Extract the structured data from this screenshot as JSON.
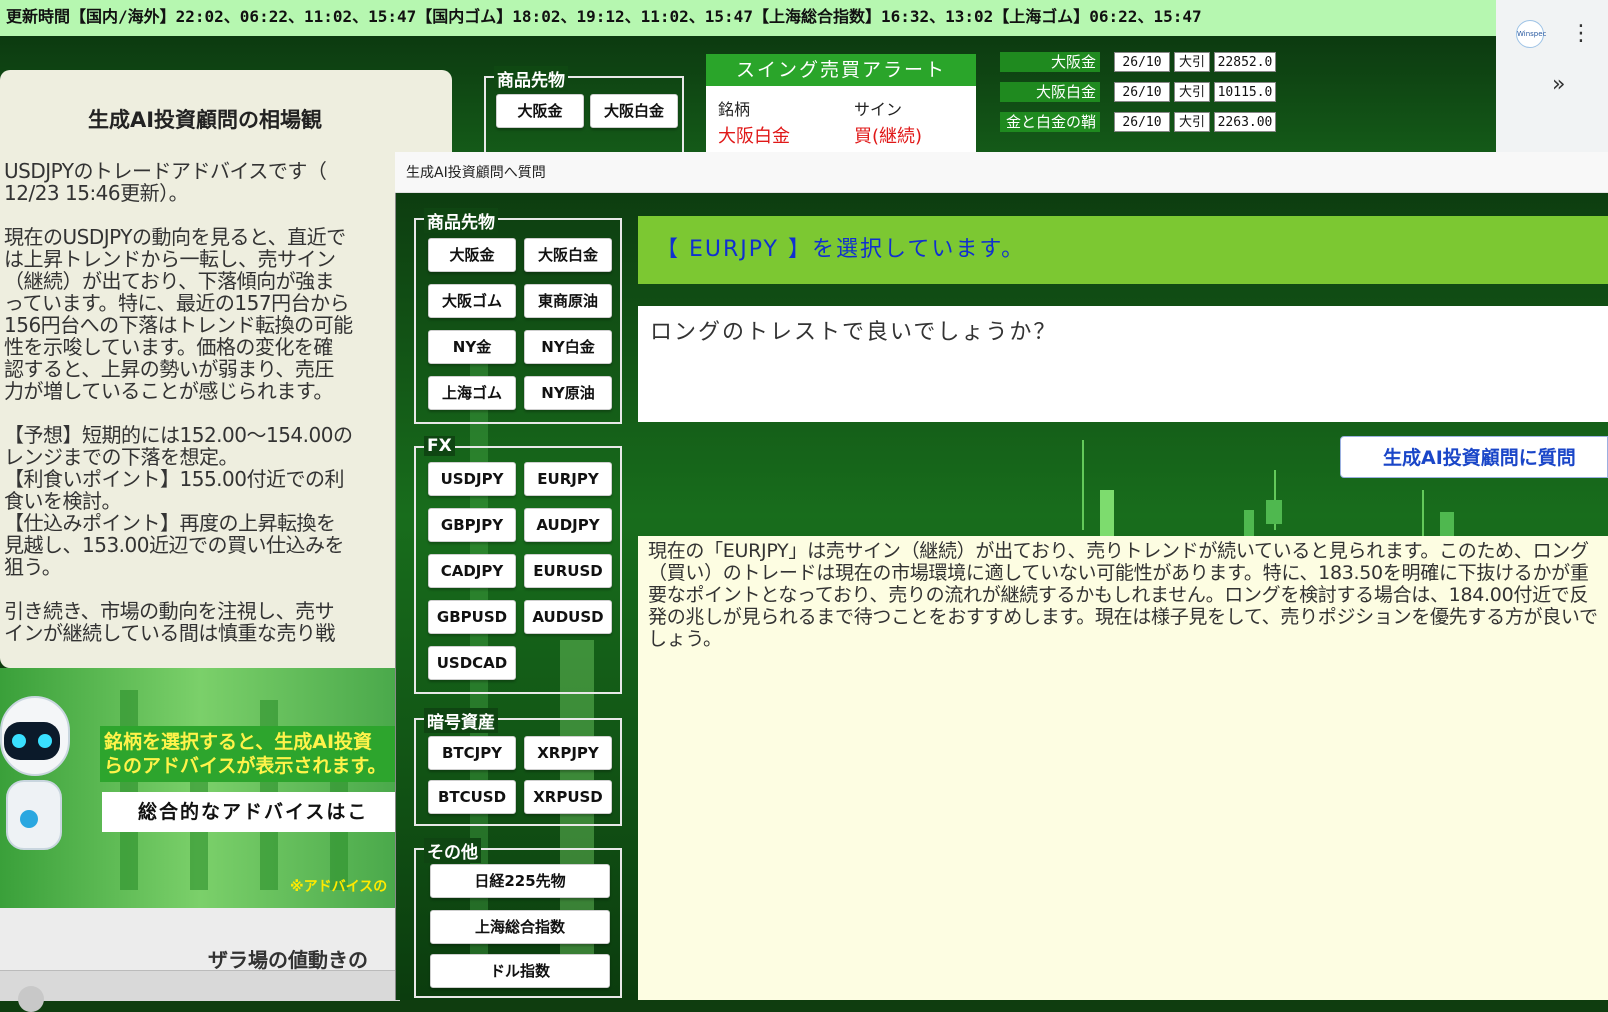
{
  "ticker": "更新時間【国内/海外】22:02、06:22、11:02、15:47【国内ゴム】18:02、19:12、11:02、15:47【上海総合指数】16:32、13:02【上海ゴム】06:22、15:47",
  "browser": {
    "extension_label": "Winspec",
    "menu_icon": "⋮",
    "overflow_icon": "»"
  },
  "bg_page": {
    "commodity_legend": "商品先物",
    "buttons": [
      "大阪金",
      "大阪白金"
    ],
    "alert": {
      "title": "スイング売買アラート",
      "col_symbol": "銘柄",
      "col_signal": "サイン",
      "rows": [
        {
          "symbol": "大阪白金",
          "signal": "買(継続)"
        }
      ]
    },
    "prices": [
      {
        "label": "大阪金",
        "month": "26/10",
        "session": "大引",
        "price": "22852.0"
      },
      {
        "label": "大阪白金",
        "month": "26/10",
        "session": "大引",
        "price": "10115.0"
      },
      {
        "label": "金と白金の鞘",
        "month": "26/10",
        "session": "大引",
        "price": "2263.00"
      }
    ]
  },
  "left_panel": {
    "title": "生成AI投資顧問の相場観",
    "text": "USDJPYのトレードアドバイスです（\n12/23 15:46更新）。\n\n現在のUSDJPYの動向を見ると、直近で\nは上昇トレンドから一転し、売サイン\n（継続）が出ており、下落傾向が強ま\nっています。特に、最近の157円台から\n156円台への下落はトレンド転換の可能\n性を示唆しています。価格の変化を確\n認すると、上昇の勢いが弱まり、売圧\n力が増していることが感じられます。\n\n【予想】短期的には152.00～154.00の\nレンジまでの下落を想定。\n【利食いポイント】155.00付近での利\n食いを検討。\n【仕込みポイント】再度の上昇転換を\n見越し、153.00近辺での買い仕込みを\n狙う。\n\n引き続き、市場の動向を注視し、売サ\nインが継続している間は慎重な売り戦",
    "promo_message": "銘柄を選択すると、生成AI投資\nらのアドバイスが表示されます。",
    "promo_button": "総合的なアドバイスはこ",
    "promo_note": "※アドバイスの",
    "lower_title": "ザラ場の値動きの"
  },
  "dialog": {
    "title": "生成AI投資顧問へ質問",
    "groups": [
      {
        "legend": "商品先物",
        "buttons": [
          "大阪金",
          "大阪白金",
          "大阪ゴム",
          "東商原油",
          "NY金",
          "NY白金",
          "上海ゴム",
          "NY原油"
        ]
      },
      {
        "legend": "FX",
        "buttons": [
          "USDJPY",
          "EURJPY",
          "GBPJPY",
          "AUDJPY",
          "CADJPY",
          "EURUSD",
          "GBPUSD",
          "AUDUSD",
          "USDCAD"
        ]
      },
      {
        "legend": "暗号資産",
        "buttons": [
          "BTCJPY",
          "XRPJPY",
          "BTCUSD",
          "XRPUSD"
        ]
      },
      {
        "legend": "その他",
        "buttons": [
          "日経225先物",
          "上海総合指数",
          "ドル指数"
        ]
      }
    ],
    "selected_banner": "【 EURJPY 】を選択しています。",
    "question": "ロングのトレストで良いでしょうか？",
    "ask_button": "生成AI投資顧問に質問",
    "answer": "現在の「EURJPY」は売サイン（継続）が出ており、売りトレンドが続いていると見られます。このため、ロング（買い）のトレードは現在の市場環境に適していない可能性があります。特に、183.50を明確に下抜けるかが重要なポイントとなっており、売りの流れが継続するかもしれません。ロングを検討する場合は、184.00付近で反発の兆しが見られるまで待つことをおすすめします。現在は様子見をして、売りポジションを優先する方が良いでしょう。"
  },
  "colors": {
    "ticker_bg": "#b6f7b0",
    "banner_bg": "#7cc832",
    "answer_bg": "#fdfde2",
    "accent_blue": "#1030d0"
  }
}
